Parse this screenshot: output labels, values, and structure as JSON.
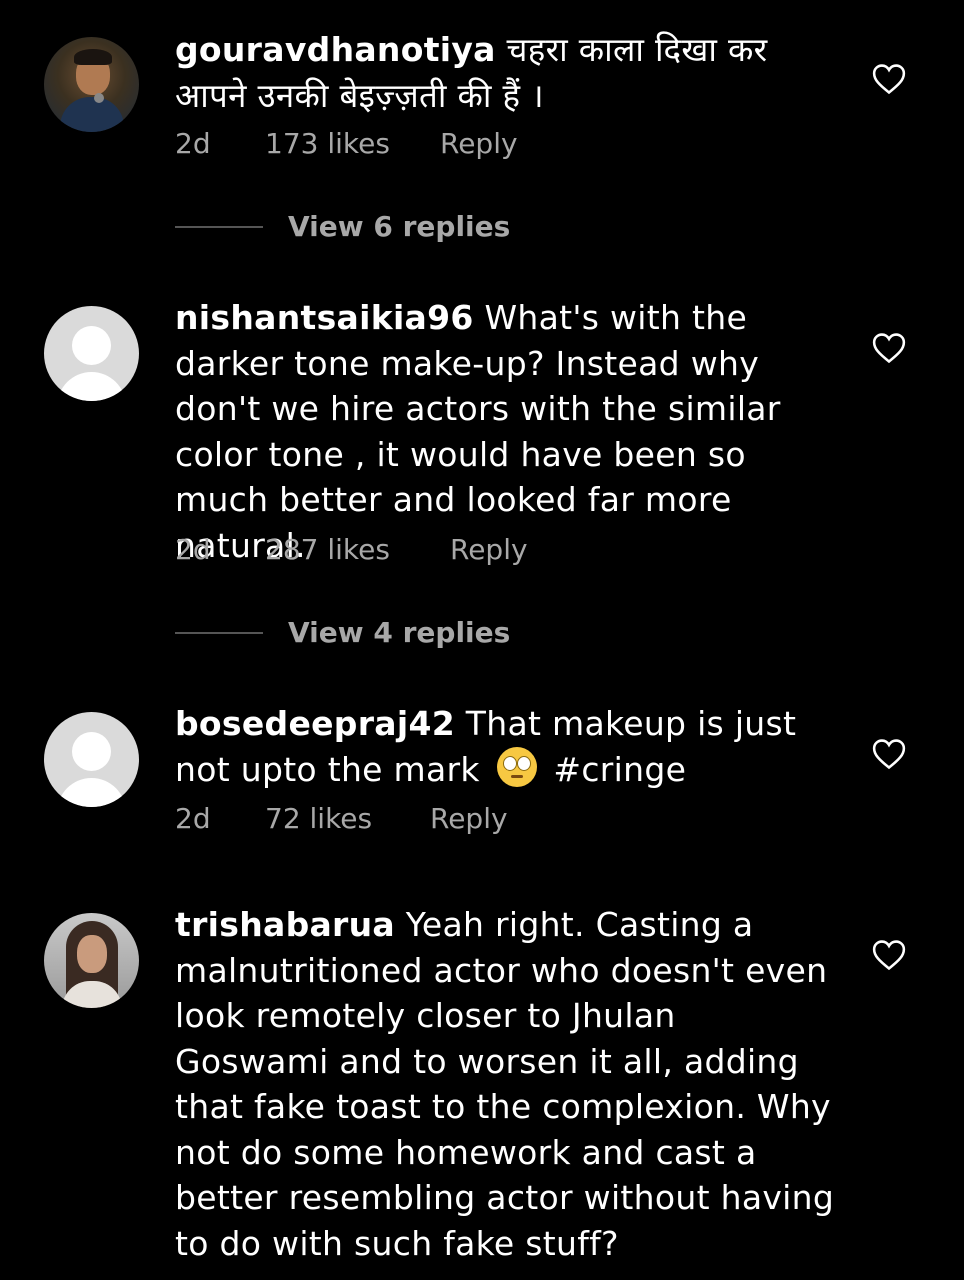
{
  "comments": [
    {
      "username": "gouravdhanotiya",
      "text": " चहरा काला दिखा कर आपने उनकी बेइज़्ज़ती की हैं ।",
      "time": "2d",
      "likes": "173 likes",
      "reply": "Reply",
      "view_replies": "View 6 replies"
    },
    {
      "username": "nishantsaikia96",
      "text": " What's with the darker tone make-up? Instead why don't we hire actors with the similar color tone , it would have been so much better and looked far more natural.",
      "time": "2d",
      "likes": "287 likes",
      "reply": "Reply",
      "view_replies": "View 4 replies"
    },
    {
      "username": "bosedeepraj42",
      "text_before": " That makeup is just not upto the mark ",
      "emoji": "face-with-rolling-eyes",
      "text_after": " #cringe",
      "time": "2d",
      "likes": "72 likes",
      "reply": "Reply"
    },
    {
      "username": "trishabarua",
      "text": " Yeah right. Casting a malnutritioned actor who doesn't even look remotely closer to Jhulan Goswami and to worsen it all, adding that fake toast to the complexion. Why not do some homework and cast a better resembling actor without having to do with such fake stuff?"
    }
  ],
  "icons": {
    "like": "heart-outline-icon"
  },
  "colors": {
    "background": "#000000",
    "text": "#ffffff",
    "secondary": "#a8a8a8"
  }
}
